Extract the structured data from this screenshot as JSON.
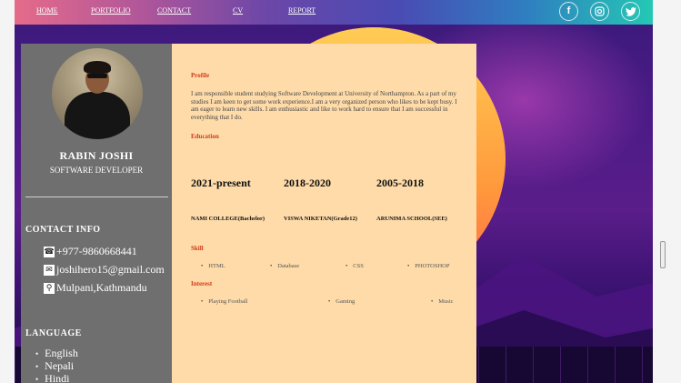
{
  "nav": {
    "links": [
      "HOME",
      "PORTFOLIO",
      "CONTACT",
      "CV",
      "REPORT"
    ],
    "social": [
      "facebook-icon",
      "instagram-icon",
      "twitter-icon"
    ]
  },
  "profile_card": {
    "name": "RABIN JOSHI",
    "title": "SOFTWARE DEVELOPER",
    "contact_heading": "CONTACT INFO",
    "phone": "+977-9860668441",
    "email": "joshihero15@gmail.com",
    "address": "Mulpani,Kathmandu",
    "language_heading": "LANGUAGE",
    "languages": [
      "English",
      "Nepali",
      "Hindi"
    ]
  },
  "main": {
    "profile_heading": "Profile",
    "profile_text": "I am responsible student studying Software Development at University of Northampton. As a part of my studies I am keen to get some work experience.I am a very organized person who likes to be kept busy. I am eager to learn new skills. I am enthusiastic and like to work hard to ensure that I am successful in everything that I do.",
    "education_heading": "Education",
    "education": [
      {
        "years": "2021-present",
        "school": "NAMI COLLEGE(Bachelor)"
      },
      {
        "years": "2018-2020",
        "school": "VISWA NIKETAN(Grade12)"
      },
      {
        "years": "2005-2018",
        "school": "ARUNIMA SCHOOL(SEE)"
      }
    ],
    "skill_heading": "Skill",
    "skills": [
      "HTML",
      "Database",
      "CSS",
      "PHOTOSHOP"
    ],
    "interest_heading": "Interest",
    "interests": [
      "Playing Football",
      "Gaming",
      "Music"
    ]
  },
  "colors": {
    "accent": "#d03a1a",
    "content_bg": "#fedba9",
    "sidebar_bg": "#6f6f6f"
  }
}
